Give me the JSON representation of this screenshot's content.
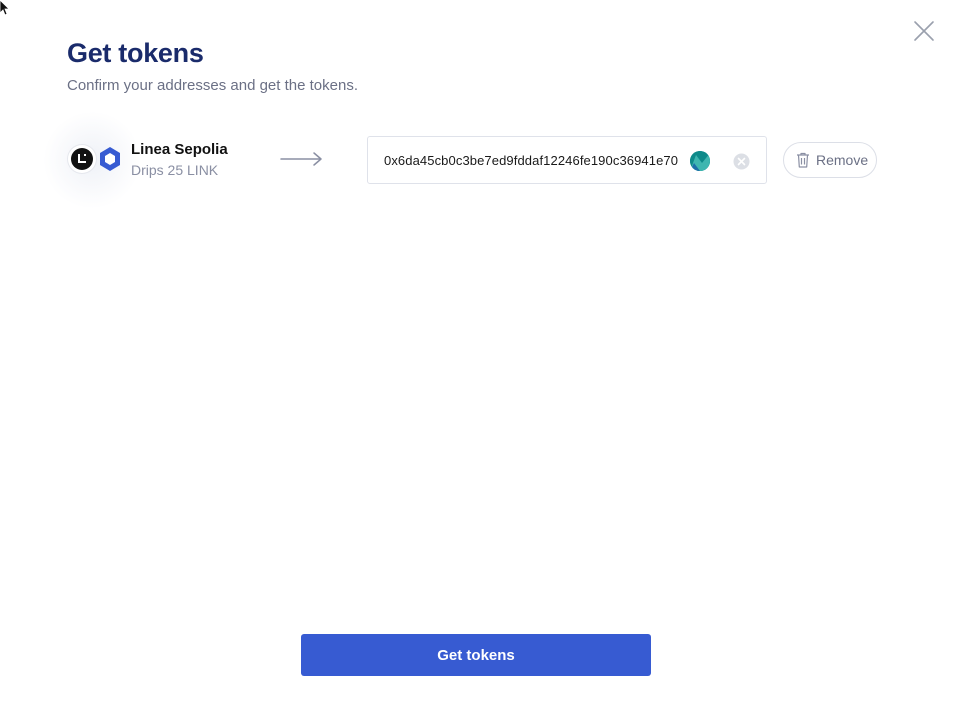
{
  "dialog": {
    "title": "Get tokens",
    "subtitle": "Confirm your addresses and get the tokens."
  },
  "network": {
    "name": "Linea Sepolia",
    "drip": "Drips 25 LINK",
    "network_icon": "linea-logo-icon",
    "token_icon": "chainlink-logo-icon"
  },
  "address": {
    "value": "0x6da45cb0c3be7ed9fddaf12246fe190c36941e70"
  },
  "actions": {
    "remove_label": "Remove",
    "submit_label": "Get tokens"
  },
  "colors": {
    "primary": "#375bd2",
    "title": "#1a2b6b",
    "muted": "#6b7085",
    "avatar": "#0e8a8a"
  }
}
